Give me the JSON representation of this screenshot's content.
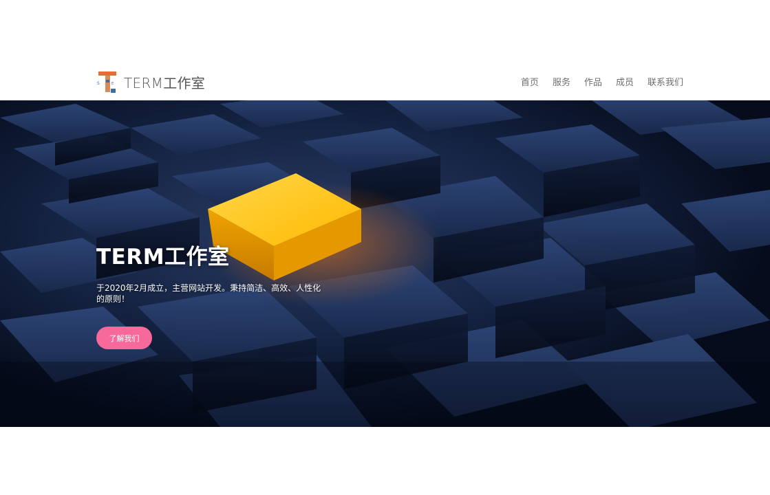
{
  "navbar": {
    "brand_name": "TERM工作室",
    "logo_letters": "TERM",
    "links": [
      "首页",
      "服务",
      "作品",
      "成员",
      "联系我们"
    ]
  },
  "hero": {
    "title": "TERM工作室",
    "description": "于2020年2月成立，主营网站开发。秉持简洁、高效、人性化的原则！",
    "button_label": "了解我们"
  },
  "colors": {
    "button_pink": "#f7699b",
    "hero_dark_blue": "#0d1a33",
    "cube_yellow": "#ffc21a",
    "logo_orange": "#e0703a",
    "logo_blue": "#3a6ea8"
  },
  "icons": {
    "brand_logo": "term-logo-icon"
  }
}
